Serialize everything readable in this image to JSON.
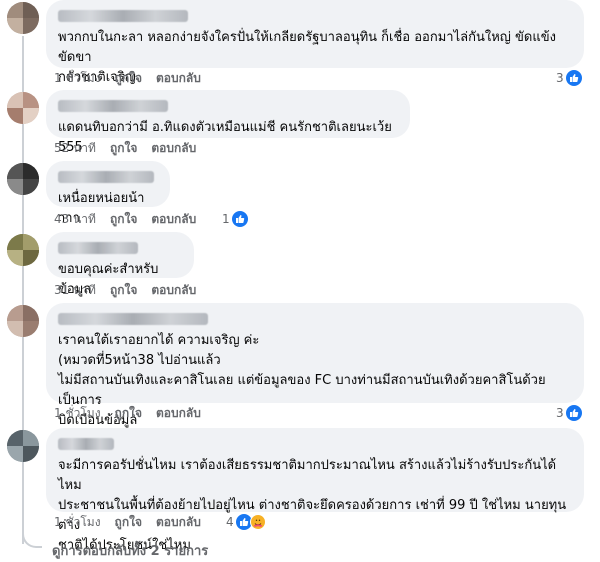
{
  "colors": {
    "bubble": "#f0f2f5",
    "meta_text": "#65676b",
    "like_blue": "#1877f2",
    "thread_line": "#ccd0d5"
  },
  "comments": [
    {
      "text": "พวกกบในกะลา หลอกง่ายจังใครปั่นให้เกลียดรัฐบาลอนุทิน ก็เชื่อ ออกมาไล่กันใหญ่ ขัดแข้งขัดขา\nกลัวชาติเจริญ",
      "time": "1 ชั่วโมง",
      "like_label": "ถูกใจ",
      "reply_label": "ตอบกลับ",
      "reaction_count": "3",
      "reaction_icons": [
        "like-icon"
      ]
    },
    {
      "text": "แดดนทิบอกว่ามี อ.ทิแดงตัวเหมือนแม่ชี คนรักชาติเลยนะเว้ย 555",
      "time": "52 นาที",
      "like_label": "ถูกใจ",
      "reply_label": "ตอบกลับ",
      "reaction_count": "",
      "reaction_icons": []
    },
    {
      "text": "เหนื่อยหน่อยน้าาาา",
      "time": "43 นาที",
      "like_label": "ถูกใจ",
      "reply_label": "ตอบกลับ",
      "reaction_count": "1",
      "reaction_icons": [
        "like-icon"
      ]
    },
    {
      "text": "ขอบคุณค่ะสำหรับข้อมูล",
      "time": "31 นาที",
      "like_label": "ถูกใจ",
      "reply_label": "ตอบกลับ",
      "reaction_count": "",
      "reaction_icons": []
    },
    {
      "text": "เราคนใต้เราอยากได้ ความเจริญ ค่ะ\n(หมวดที่5หน้า38 ไปอ่านแล้ว\nไม่มีสถานบันเทิงและคาสิโนเลย แต่ข้อมูลของ FC บางท่านมีสถานบันเทิงด้วยคาสิโนด้วยเป็นการ\nบิดเบือนข้อมูล",
      "time": "1 ชั่วโมง",
      "like_label": "ถูกใจ",
      "reply_label": "ตอบกลับ",
      "reaction_count": "3",
      "reaction_icons": [
        "like-icon"
      ]
    },
    {
      "text": "จะมีการคอรัปชั่นไหม เราต้องเสียธรรมชาติมากประมาณไหน สร้างแล้วไม่ร้างรับประกันได้ไหม\nประชาชนในพื้นที่ต้องย้ายไปอยู่ไหน ต่างชาติจะยึดครองด้วยการ เช่าที่ 99 ปี ใช่ไหม นายทุนต่าง\nชาติได้ประโยชน์ใช่ไหม",
      "time": "1 ชั่วโมง",
      "like_label": "ถูกใจ",
      "reply_label": "ตอบกลับ",
      "reaction_count": "4",
      "reaction_icons": [
        "like-icon",
        "care-icon"
      ]
    }
  ],
  "see_replies": "ดูการตอบกลับทั้ง 2 รายการ"
}
